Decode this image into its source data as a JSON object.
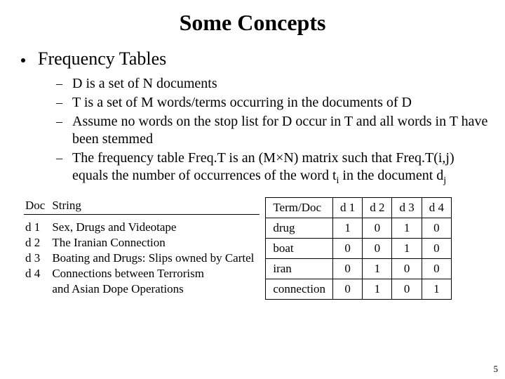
{
  "title": "Some Concepts",
  "bullet": "Frequency Tables",
  "sub": [
    "D is a set of N documents",
    "T is a set of M words/terms occurring in the documents of D",
    "Assume no words on the stop list for D occur in T and all words in T have been stemmed",
    "The frequency table Freq.T is an (M×N) matrix such that Freq.T(i,j) equals the number of occurrences of the word t"
  ],
  "sub_tail_a": " in the document d",
  "docTable": {
    "headers": [
      "Doc",
      "String"
    ],
    "rows": [
      [
        "d 1",
        "Sex, Drugs and Videotape"
      ],
      [
        "d 2",
        "The Iranian Connection"
      ],
      [
        "d 3",
        "Boating and Drugs: Slips owned by Cartel"
      ],
      [
        "d 4",
        "Connections between Terrorism"
      ]
    ],
    "wrap": "and Asian Dope Operations"
  },
  "freqTable": {
    "header": [
      "Term/Doc",
      "d 1",
      "d 2",
      "d 3",
      "d 4"
    ],
    "rows": [
      [
        "drug",
        "1",
        "0",
        "1",
        "0"
      ],
      [
        "boat",
        "0",
        "0",
        "1",
        "0"
      ],
      [
        "iran",
        "0",
        "1",
        "0",
        "0"
      ],
      [
        "connection",
        "0",
        "1",
        "0",
        "1"
      ]
    ]
  },
  "pageNum": "5",
  "chart_data": {
    "type": "table",
    "title": "Frequency Table Freq.T",
    "columns": [
      "Term/Doc",
      "d 1",
      "d 2",
      "d 3",
      "d 4"
    ],
    "rows": [
      {
        "Term/Doc": "drug",
        "d 1": 1,
        "d 2": 0,
        "d 3": 1,
        "d 4": 0
      },
      {
        "Term/Doc": "boat",
        "d 1": 0,
        "d 2": 0,
        "d 3": 1,
        "d 4": 0
      },
      {
        "Term/Doc": "iran",
        "d 1": 0,
        "d 2": 1,
        "d 3": 0,
        "d 4": 0
      },
      {
        "Term/Doc": "connection",
        "d 1": 0,
        "d 2": 1,
        "d 3": 0,
        "d 4": 1
      }
    ]
  }
}
